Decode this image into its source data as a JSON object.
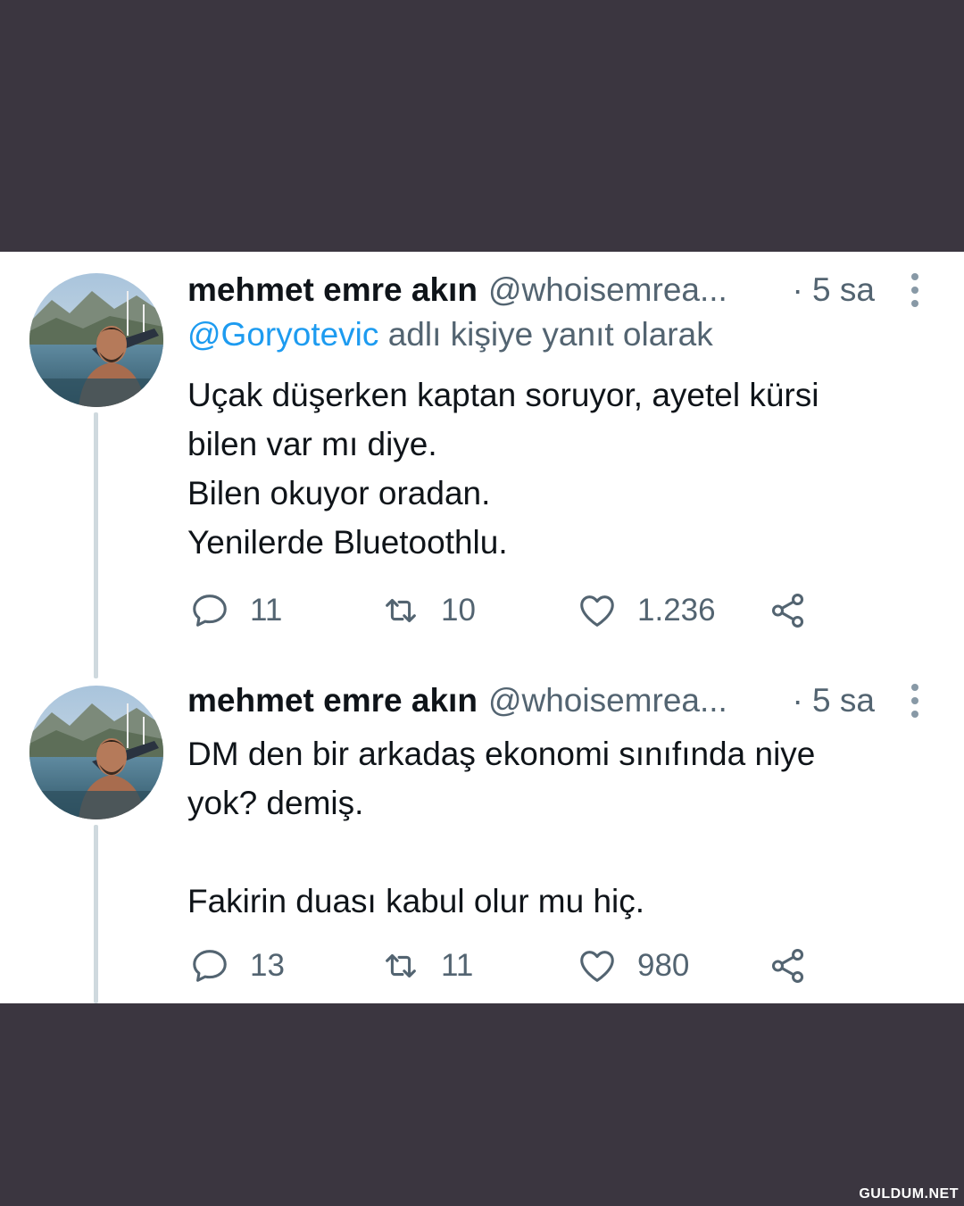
{
  "tweets": [
    {
      "author_name": "mehmet emre akın",
      "handle": "@whoisemrea...",
      "time": "· 5 sa",
      "reply_to": "@Goryotevic",
      "reply_suffix": "adlı kişiye yanıt olarak",
      "text": "Uçak düşerken kaptan soruyor, ayetel kürsi\nbilen var mı diye.\nBilen okuyor oradan.\nYenilerde Bluetoothlu.",
      "replies": "11",
      "retweets": "10",
      "likes": "1.236"
    },
    {
      "author_name": "mehmet emre akın",
      "handle": "@whoisemrea...",
      "time": "· 5 sa",
      "text": "DM den bir arkadaş ekonomi sınıfında niye\nyok? demiş.\n\nFakirin duası kabul olur mu hiç.",
      "replies": "13",
      "retweets": "11",
      "likes": "980"
    }
  ],
  "watermark": "GULDUM.NET",
  "colors": {
    "background": "#3b3640",
    "card": "#ffffff",
    "text": "#0f1419",
    "secondary": "#536471",
    "link": "#1d9bf0",
    "thread_line": "#cfd9de"
  },
  "icons": [
    "reply-icon",
    "retweet-icon",
    "like-icon",
    "share-icon",
    "more-icon"
  ]
}
